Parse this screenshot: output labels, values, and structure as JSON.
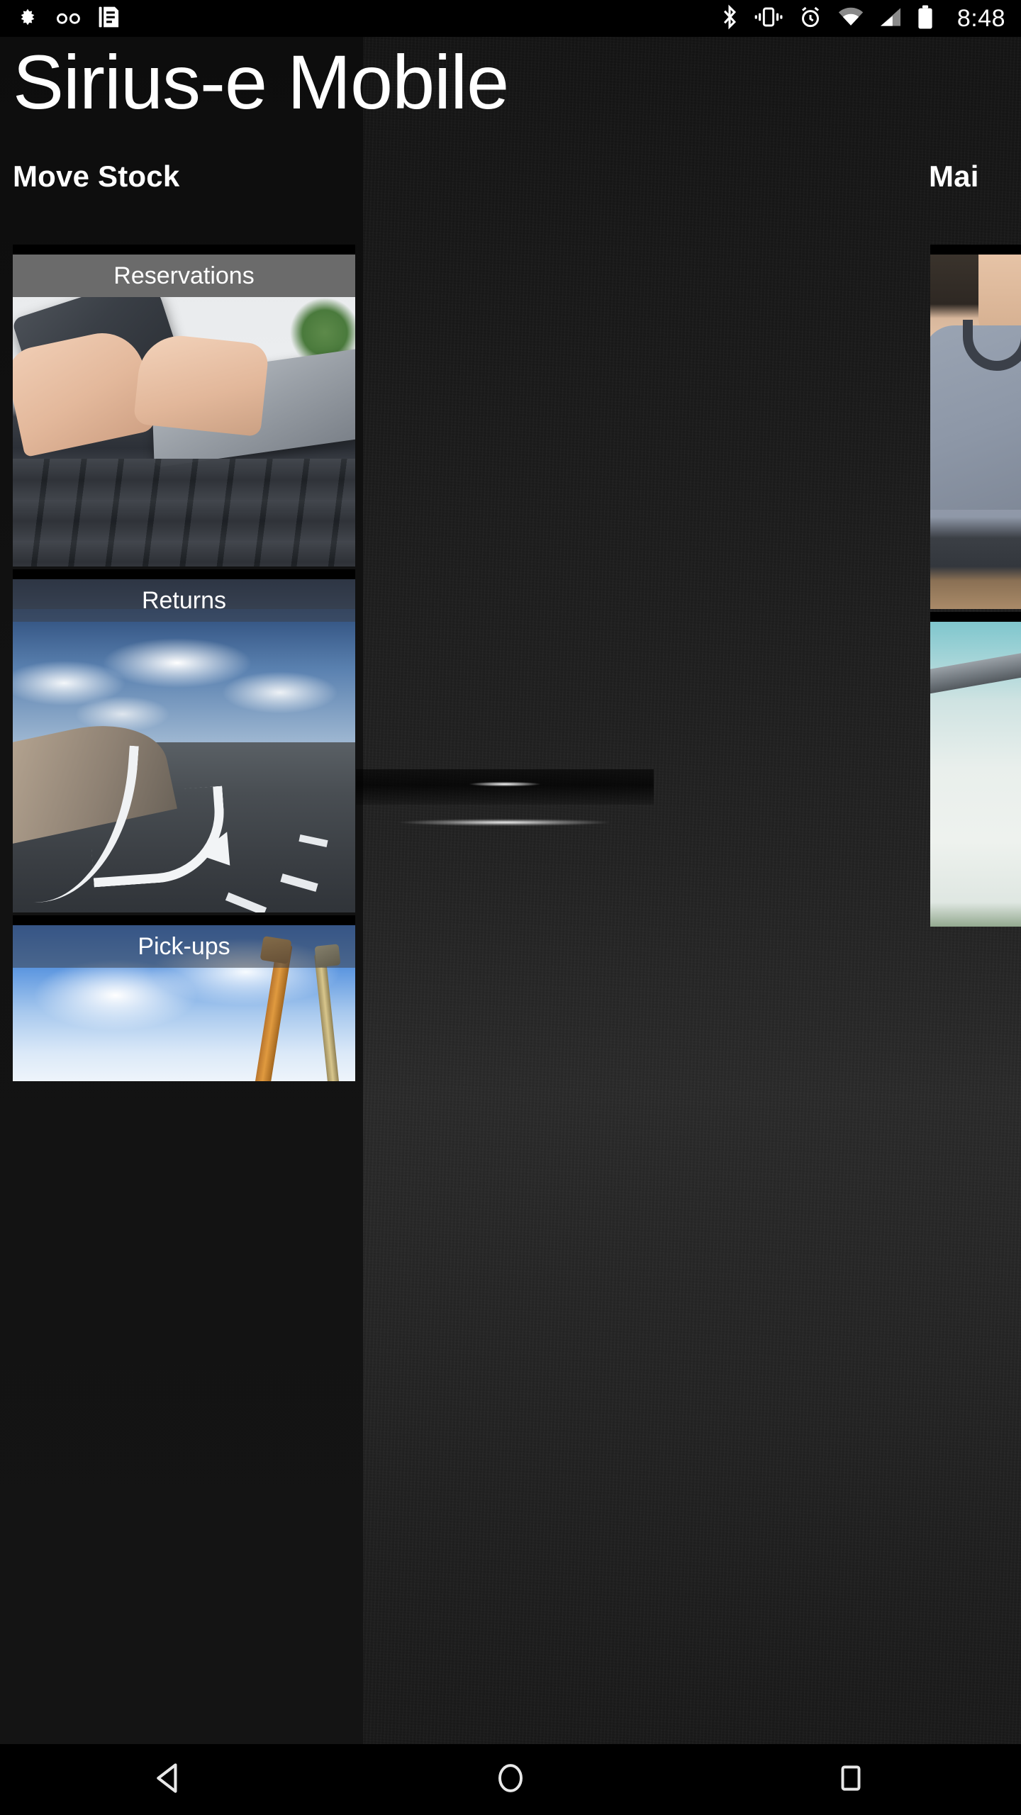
{
  "statusbar": {
    "time": "8:48",
    "left_icons": [
      "brightness-icon",
      "voicemail-icon",
      "notes-icon"
    ],
    "right_icons": [
      "bluetooth-icon",
      "vibrate-icon",
      "alarm-icon",
      "wifi-icon",
      "cell-signal-icon",
      "battery-icon"
    ]
  },
  "app": {
    "title": "Sirius-e Mobile"
  },
  "sections": [
    {
      "title": "Move Stock"
    },
    {
      "title": "Mai"
    }
  ],
  "left_column": {
    "cards": [
      {
        "label": "Reservations",
        "image": "desk-phone-handset-keyboard"
      },
      {
        "label": "Returns",
        "image": "highway-road-u-turn-arrow"
      },
      {
        "label": "Pick-ups",
        "image": "construction-cranes-blue-sky"
      }
    ]
  },
  "right_column": {
    "cards": [
      {
        "label": "",
        "image": "person-grey-tshirt"
      },
      {
        "label": "",
        "image": "laptop-on-desk"
      }
    ]
  },
  "navbar": {
    "buttons": [
      {
        "name": "back",
        "icon": "back-triangle-icon"
      },
      {
        "name": "home",
        "icon": "home-circle-icon"
      },
      {
        "name": "recents",
        "icon": "recents-square-icon"
      }
    ]
  },
  "colors": {
    "background": "#1b1b1b",
    "panel_dark": "#0d0d0d",
    "label_band": "#6b6b6b",
    "text": "#ffffff",
    "statusbar": "#000000"
  }
}
